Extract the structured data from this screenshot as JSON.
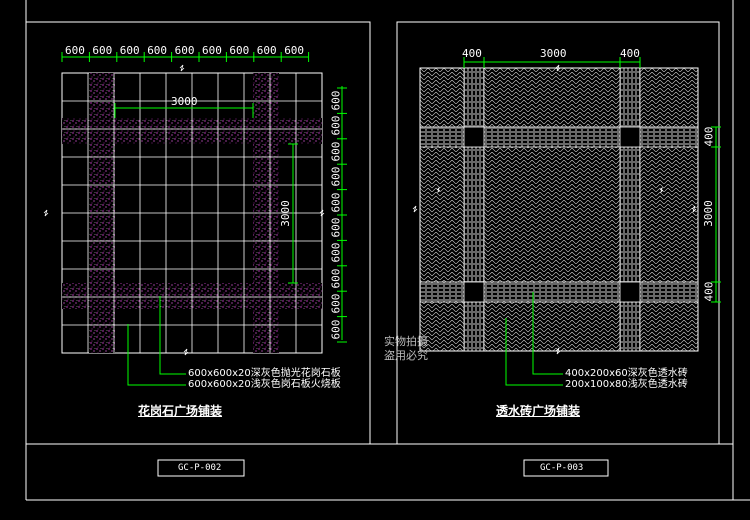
{
  "left_panel": {
    "top_dims": [
      "600",
      "600",
      "600",
      "600",
      "600",
      "600",
      "600",
      "600",
      "600"
    ],
    "inner_dim": "3000",
    "right_dims": [
      "600",
      "600",
      "600",
      "600",
      "600",
      "600",
      "600",
      "600",
      "600",
      "600"
    ],
    "right_inner_dim": "3000",
    "note_1": "600x600x20深灰色抛光花岗石板",
    "note_2": "600x600x20浅灰色岗石板火烧板",
    "title": "花岗石广场铺装",
    "code": "GC-P-002"
  },
  "right_panel": {
    "top_dims": [
      "400",
      "3000",
      "400"
    ],
    "right_dims": [
      "400",
      "3000",
      "400"
    ],
    "note_1": "400x200x60深灰色透水砖",
    "note_2": "200x100x80浅灰色透水砖",
    "title": "透水砖广场铺装",
    "code": "GC-P-003"
  },
  "watermark": [
    "实物拍摄",
    "盗用必究"
  ],
  "colors": {
    "background": "#000000",
    "line": "#ffffff",
    "dimension": "#00ff00",
    "granite": "#c040c0",
    "leader": "#00ff00"
  }
}
